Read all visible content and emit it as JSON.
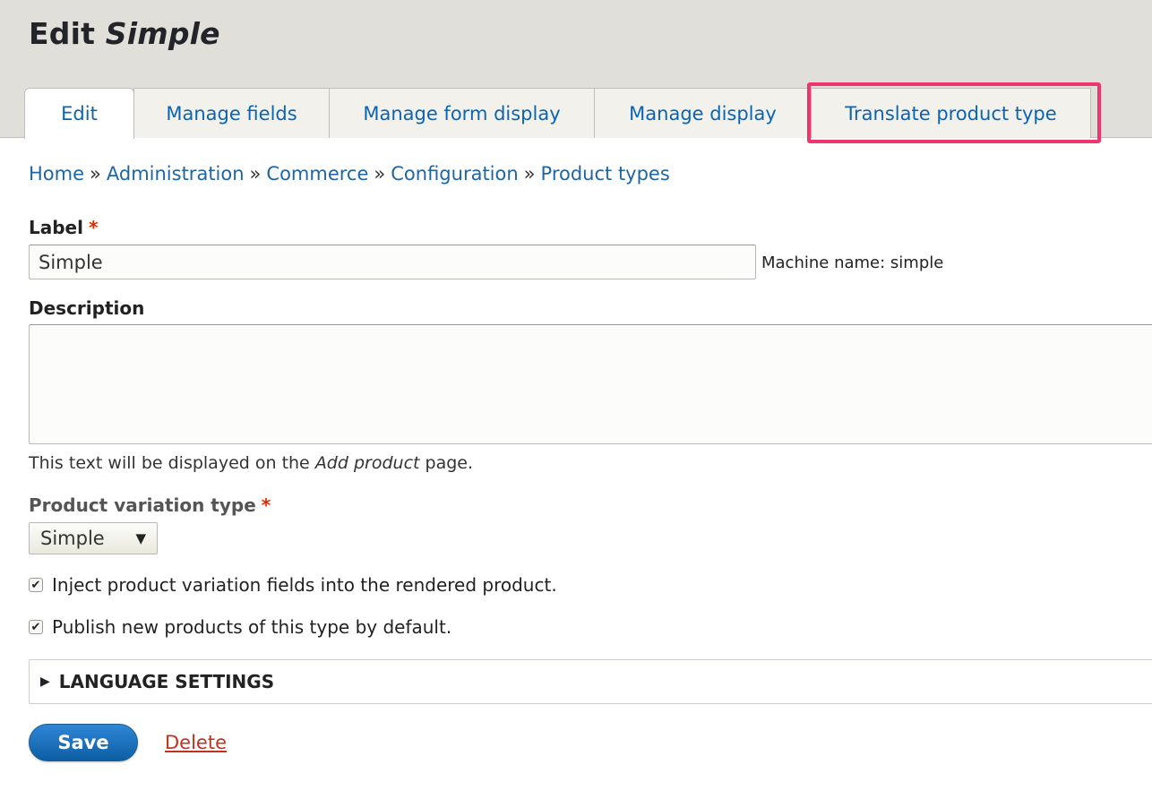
{
  "page": {
    "title_prefix": "Edit",
    "title_name": "Simple"
  },
  "tabs": [
    {
      "label": "Edit"
    },
    {
      "label": "Manage fields"
    },
    {
      "label": "Manage form display"
    },
    {
      "label": "Manage display"
    },
    {
      "label": "Translate product type"
    }
  ],
  "breadcrumb": {
    "items": [
      "Home",
      "Administration",
      "Commerce",
      "Configuration",
      "Product types"
    ],
    "separator": "»"
  },
  "form": {
    "label_field": {
      "label": "Label",
      "required_marker": "*",
      "value": "Simple",
      "machine_name": "Machine name: simple"
    },
    "description_field": {
      "label": "Description",
      "help_prefix": "This text will be displayed on the",
      "help_emph": "Add product",
      "help_suffix": "page."
    },
    "variation_type": {
      "label": "Product variation type",
      "required_marker": "*",
      "selected": "Simple"
    },
    "checkboxes": [
      {
        "label": "Inject product variation fields into the rendered product.",
        "checked": true
      },
      {
        "label": "Publish new products of this type by default.",
        "checked": true
      }
    ],
    "language_settings": "LANGUAGE SETTINGS",
    "save_label": "Save",
    "delete_label": "Delete"
  },
  "colors": {
    "highlight": "#f0356e",
    "link": "#1d65a6",
    "primary_button": "#1f6fbf",
    "required": "#e32700",
    "delete": "#c4311d"
  }
}
